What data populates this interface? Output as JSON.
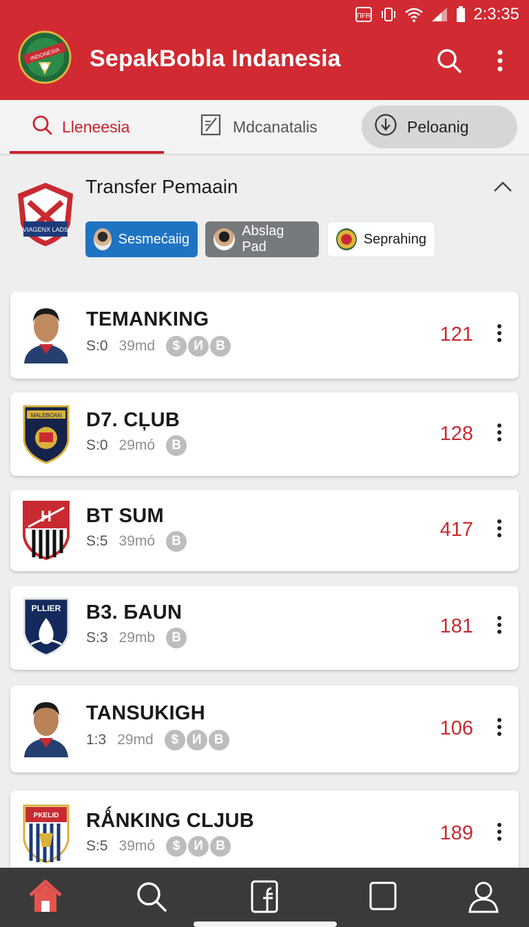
{
  "status_bar": {
    "time": "2:3:35",
    "carrier_icon_text": "ΠFR"
  },
  "app": {
    "title": "SepakBobla Indanesia",
    "logo_text": "INDONESIA"
  },
  "tabs": [
    {
      "label": "Lleneesia",
      "icon": "search-icon"
    },
    {
      "label": "Mdcanatalis",
      "icon": "notepad-icon"
    },
    {
      "label": "Peloanig",
      "icon": "download-circle-icon"
    }
  ],
  "transfer": {
    "title": "Transfer Pemaain",
    "badge_text": "VIAGENX LADS",
    "chips": [
      {
        "label": "Sesmećaiig"
      },
      {
        "label": "Abslag Pad"
      },
      {
        "label": "Seprahing"
      }
    ]
  },
  "list": [
    {
      "name": "TEMANKING",
      "stat": "S:0",
      "time": "39md",
      "coins": [
        "$",
        "И",
        "B"
      ],
      "score": "121",
      "thumb": "player"
    },
    {
      "name": "D7. CĻUB",
      "stat": "S:0",
      "time": "29mó",
      "coins": [
        "B"
      ],
      "score": "128",
      "thumb": "crest-navy",
      "crest_text": "MALEBOAN"
    },
    {
      "name": "BT  SUM",
      "stat": "S:5",
      "time": "39mó",
      "coins": [
        "B"
      ],
      "score": "417",
      "thumb": "crest-red",
      "crest_text": "H"
    },
    {
      "name": "B3. БAUN",
      "stat": "S:3",
      "time": "29mb",
      "coins": [
        "B"
      ],
      "score": "181",
      "thumb": "crest-blue",
      "crest_text": "PLLIER"
    },
    {
      "name": "TANSUKIGH",
      "stat": "1:3",
      "time": "29md",
      "coins": [
        "$",
        "И",
        "B"
      ],
      "score": "106",
      "thumb": "player"
    },
    {
      "name": "RǺNKING CLJUB",
      "stat": "S:5",
      "time": "39mó",
      "coins": [
        "$",
        "И",
        "B"
      ],
      "score": "189",
      "thumb": "crest-stripe",
      "crest_text": "PKELID"
    }
  ],
  "colors": {
    "primary": "#d12a32",
    "accent_text": "#c72b31",
    "chip_blue": "#1f73c3",
    "chip_gray": "#777a7d",
    "nav_bg": "#3a3a3a"
  },
  "bottom_nav": [
    "home-icon",
    "search-icon",
    "facebook-icon",
    "square-icon",
    "profile-icon"
  ]
}
